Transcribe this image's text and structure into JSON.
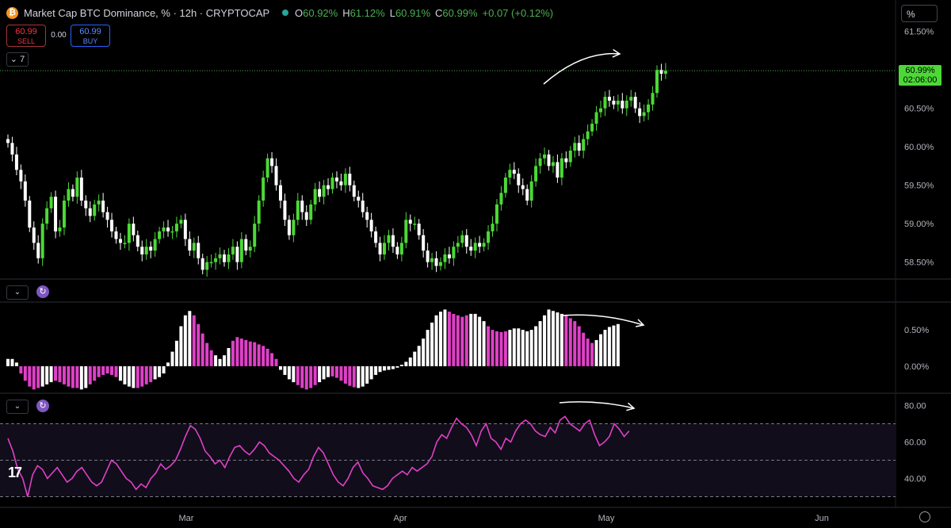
{
  "header": {
    "title": "Market Cap BTC Dominance, % · 12h · CRYPTOCAP",
    "symbol_icon": "bitcoin-icon",
    "ohlc": [
      {
        "k": "O",
        "v": "60.92%"
      },
      {
        "k": "H",
        "v": "61.12%"
      },
      {
        "k": "L",
        "v": "60.91%"
      },
      {
        "k": "C",
        "v": "60.99%"
      },
      {
        "k": "",
        "v": "+0.07 (+0.12%)"
      }
    ],
    "sell_price": "60.99",
    "sell_label": "SELL",
    "buy_price": "60.99",
    "buy_label": "BUY",
    "spread": "0.00",
    "collapse_label": "7",
    "scale_mode": "%"
  },
  "price_label": {
    "value": "60.99%",
    "countdown": "02:06:00"
  },
  "colors": {
    "up": "#4cd936",
    "down": "#ffffff",
    "histo_pos": "#e040c8",
    "histo_white": "#ffffff",
    "rsi": "#e040c8",
    "price_line": "#4caf50"
  },
  "chart_data": [
    {
      "type": "candlestick",
      "title": "Market Cap BTC Dominance, %",
      "y_ticks": [
        "61.50%",
        "61.00%",
        "60.50%",
        "60.00%",
        "59.50%",
        "59.00%",
        "58.50%"
      ],
      "ylim": [
        58.3,
        61.6
      ],
      "x_ticks": [
        "Mar",
        "Apr",
        "May",
        "Jun"
      ],
      "close": [
        60.05,
        59.9,
        59.7,
        59.55,
        59.3,
        58.95,
        58.75,
        58.55,
        59.0,
        59.2,
        59.35,
        58.9,
        58.95,
        59.3,
        59.45,
        59.35,
        59.6,
        59.3,
        59.2,
        59.1,
        59.25,
        59.3,
        59.15,
        59.05,
        58.9,
        58.8,
        58.75,
        58.75,
        59.0,
        58.85,
        58.7,
        58.6,
        58.7,
        58.65,
        58.8,
        58.9,
        58.95,
        58.9,
        58.9,
        59.0,
        59.05,
        58.8,
        58.65,
        58.75,
        58.55,
        58.4,
        58.5,
        58.5,
        58.55,
        58.6,
        58.5,
        58.6,
        58.7,
        58.5,
        58.8,
        58.65,
        58.7,
        59.0,
        59.3,
        59.6,
        59.85,
        59.75,
        59.5,
        59.3,
        59.05,
        58.85,
        59.05,
        59.3,
        59.15,
        59.05,
        59.25,
        59.45,
        59.35,
        59.5,
        59.45,
        59.6,
        59.55,
        59.5,
        59.65,
        59.5,
        59.35,
        59.3,
        59.15,
        59.05,
        58.9,
        58.75,
        58.6,
        58.75,
        58.85,
        58.7,
        58.6,
        58.75,
        59.05,
        59.0,
        59.0,
        58.85,
        58.65,
        58.5,
        58.55,
        58.45,
        58.5,
        58.6,
        58.55,
        58.7,
        58.75,
        58.85,
        58.7,
        58.65,
        58.75,
        58.7,
        58.75,
        58.9,
        59.0,
        59.25,
        59.4,
        59.6,
        59.7,
        59.65,
        59.5,
        59.45,
        59.3,
        59.55,
        59.75,
        59.85,
        59.9,
        59.75,
        59.8,
        59.6,
        59.85,
        59.8,
        59.95,
        60.05,
        59.95,
        60.1,
        60.2,
        60.3,
        60.45,
        60.5,
        60.65,
        60.6,
        60.55,
        60.6,
        60.5,
        60.6,
        60.65,
        60.5,
        60.4,
        60.45,
        60.55,
        60.7,
        61.0,
        60.95,
        60.99
      ],
      "last_value": 60.99
    },
    {
      "type": "histogram",
      "y_ticks": [
        "0.50%",
        "0.00%"
      ],
      "ylim": [
        -0.35,
        0.85
      ],
      "values": [
        0.1,
        0.1,
        0.05,
        -0.1,
        -0.2,
        -0.28,
        -0.32,
        -0.3,
        -0.28,
        -0.25,
        -0.22,
        -0.2,
        -0.22,
        -0.25,
        -0.28,
        -0.3,
        -0.3,
        -0.32,
        -0.3,
        -0.25,
        -0.2,
        -0.15,
        -0.12,
        -0.1,
        -0.12,
        -0.15,
        -0.2,
        -0.25,
        -0.28,
        -0.3,
        -0.3,
        -0.28,
        -0.25,
        -0.22,
        -0.18,
        -0.15,
        -0.1,
        0.05,
        0.2,
        0.35,
        0.55,
        0.7,
        0.76,
        0.7,
        0.58,
        0.45,
        0.32,
        0.22,
        0.15,
        0.1,
        0.15,
        0.25,
        0.35,
        0.4,
        0.38,
        0.36,
        0.34,
        0.33,
        0.3,
        0.28,
        0.24,
        0.18,
        0.1,
        -0.05,
        -0.12,
        -0.18,
        -0.22,
        -0.26,
        -0.3,
        -0.32,
        -0.3,
        -0.26,
        -0.22,
        -0.18,
        -0.15,
        -0.14,
        -0.16,
        -0.2,
        -0.24,
        -0.27,
        -0.29,
        -0.3,
        -0.28,
        -0.24,
        -0.18,
        -0.12,
        -0.08,
        -0.06,
        -0.05,
        -0.04,
        -0.02,
        0.02,
        0.06,
        0.12,
        0.2,
        0.28,
        0.38,
        0.5,
        0.6,
        0.7,
        0.75,
        0.78,
        0.75,
        0.72,
        0.7,
        0.68,
        0.7,
        0.72,
        0.72,
        0.68,
        0.62,
        0.55,
        0.5,
        0.48,
        0.47,
        0.48,
        0.5,
        0.52,
        0.52,
        0.5,
        0.48,
        0.5,
        0.55,
        0.62,
        0.7,
        0.78,
        0.76,
        0.74,
        0.72,
        0.7,
        0.66,
        0.62,
        0.55,
        0.46,
        0.38,
        0.32,
        0.36,
        0.44,
        0.5,
        0.54,
        0.56,
        0.58
      ],
      "white_bars": [
        0,
        1,
        2,
        8,
        9,
        10,
        17,
        18,
        26,
        27,
        28,
        29,
        34,
        35,
        36,
        37,
        38,
        39,
        40,
        41,
        42,
        48,
        49,
        50,
        51,
        63,
        64,
        65,
        66,
        72,
        73,
        74,
        81,
        82,
        83,
        84,
        85,
        86,
        87,
        88,
        89,
        90,
        91,
        92,
        93,
        94,
        95,
        96,
        97,
        98,
        99,
        100,
        101,
        107,
        108,
        109,
        110,
        116,
        117,
        118,
        119,
        120,
        121,
        122,
        123,
        124,
        125,
        126,
        127,
        128,
        136,
        137,
        138,
        139,
        140,
        141
      ]
    },
    {
      "type": "line",
      "y_ticks": [
        "80.00",
        "60.00",
        "40.00"
      ],
      "ylim": [
        25,
        85
      ],
      "band": [
        30,
        70
      ],
      "midline": 50,
      "values": [
        62,
        55,
        45,
        40,
        30,
        42,
        47,
        45,
        40,
        43,
        46,
        42,
        38,
        40,
        44,
        46,
        42,
        38,
        36,
        38,
        44,
        50,
        48,
        44,
        40,
        38,
        34,
        37,
        35,
        40,
        43,
        48,
        45,
        47,
        50,
        56,
        63,
        69,
        67,
        62,
        55,
        52,
        48,
        50,
        46,
        52,
        57,
        58,
        55,
        53,
        56,
        60,
        58,
        54,
        52,
        50,
        47,
        44,
        40,
        38,
        42,
        45,
        52,
        57,
        54,
        48,
        42,
        38,
        36,
        40,
        46,
        49,
        43,
        40,
        36,
        35,
        34,
        36,
        40,
        42,
        44,
        42,
        46,
        44,
        46,
        48,
        52,
        60,
        64,
        62,
        68,
        73,
        70,
        68,
        64,
        58,
        66,
        70,
        62,
        60,
        56,
        62,
        60,
        66,
        70,
        72,
        70,
        66,
        64,
        63,
        68,
        65,
        72,
        74,
        70,
        68,
        66,
        70,
        72,
        64,
        58,
        60,
        63,
        70,
        67,
        63,
        66
      ],
      "last_value": 66
    }
  ],
  "x_labels": [
    "Mar",
    "Apr",
    "May",
    "Jun"
  ]
}
